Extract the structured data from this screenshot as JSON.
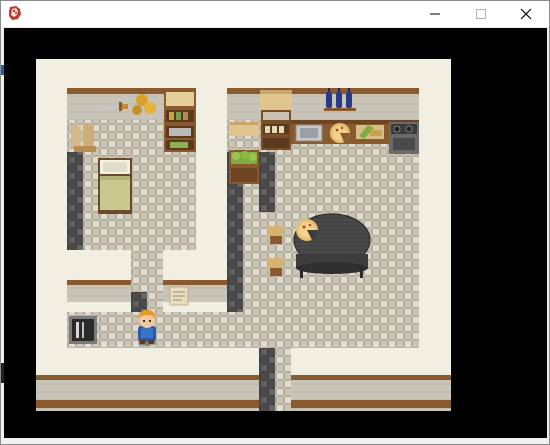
{
  "window": {
    "title": "",
    "controls": {
      "minimize_icon": "minimize-icon",
      "maximize_icon": "maximize-icon",
      "close_icon": "close-icon"
    }
  },
  "scene": {
    "background_color": "#000000",
    "wall_color": "#f1efe2",
    "floor_color": "#d4cfc2",
    "shadow_floor_color": "#5d5d5d",
    "wood_color": "#8a5a2e",
    "rooms": [
      "bedroom",
      "kitchen",
      "dining-area",
      "hallway",
      "storage-room"
    ],
    "objects": [
      "bed",
      "bookshelf",
      "wall-sword",
      "gold-sack",
      "paper-scroll",
      "wooden-crate",
      "wine-bottles",
      "kitchen-counter",
      "sink",
      "pizza",
      "stove",
      "vegetable-basket",
      "round-table",
      "stool",
      "notice-paper",
      "window",
      "hero-character"
    ]
  }
}
